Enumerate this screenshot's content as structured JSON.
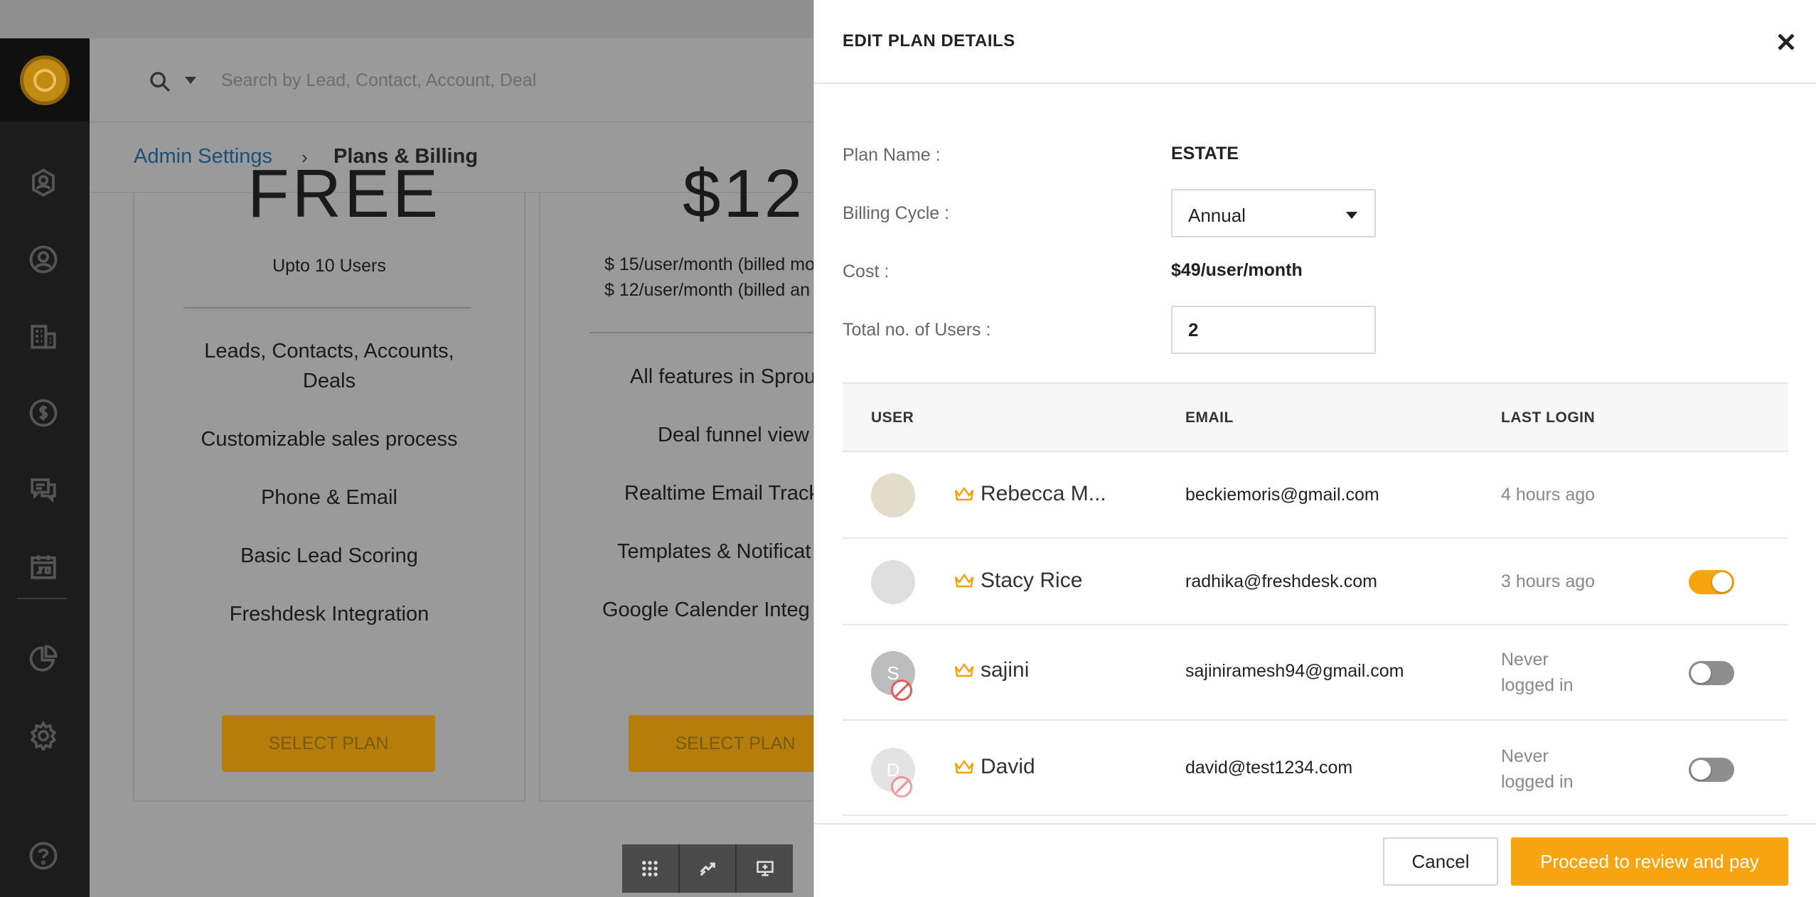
{
  "search": {
    "placeholder": "Search by Lead, Contact, Account, Deal"
  },
  "breadcrumb": {
    "parent": "Admin Settings",
    "separator": "›",
    "current": "Plans & Billing"
  },
  "plans": [
    {
      "price": "FREE",
      "subtitle_lines": [
        "Upto 10 Users"
      ],
      "features": [
        "Leads, Contacts, Accounts, Deals",
        "Customizable sales process",
        "Phone & Email",
        "Basic Lead Scoring",
        "Freshdesk Integration"
      ],
      "button": "SELECT PLAN"
    },
    {
      "price": "$12",
      "subtitle_lines": [
        "$ 15/user/month (billed mo",
        "$ 12/user/month (billed an"
      ],
      "features": [
        "All features in Sprou",
        "Deal funnel view",
        "Realtime Email Track",
        "Templates & Notificat",
        "Google Calender Integ"
      ],
      "button": "SELECT PLAN"
    }
  ],
  "panel": {
    "title": "EDIT PLAN DETAILS",
    "plan_name_label": "Plan Name :",
    "plan_name": "ESTATE",
    "billing_cycle_label": "Billing Cycle :",
    "billing_cycle": "Annual",
    "cost_label": "Cost :",
    "cost": "$49/user/month",
    "users_label": "Total no. of Users :",
    "users": "2",
    "table_headers": {
      "user": "USER",
      "email": "EMAIL",
      "last_login": "LAST LOGIN"
    },
    "rows": [
      {
        "initial": "",
        "name": "Rebecca M...",
        "email": "beckiemoris@gmail.com",
        "last_login": "4 hours ago",
        "avatar_color": "#e4dccb",
        "blocked": false,
        "toggle": null
      },
      {
        "initial": "",
        "name": "Stacy Rice",
        "email": "radhika@freshdesk.com",
        "last_login": "3 hours ago",
        "avatar_color": "#dedede",
        "blocked": false,
        "toggle": "on"
      },
      {
        "initial": "S",
        "name": "sajini",
        "email": "sajiniramesh94@gmail.com",
        "last_login": "Never logged in",
        "avatar_color": "#bdbdbd",
        "blocked": true,
        "toggle": "off"
      },
      {
        "initial": "D",
        "name": "David",
        "email": "david@test1234.com",
        "last_login": "Never logged in",
        "avatar_color": "#e3e3e3",
        "blocked": true,
        "toggle": "off"
      }
    ],
    "cancel": "Cancel",
    "proceed": "Proceed to review and pay"
  },
  "colors": {
    "accent": "#f6a40f",
    "link": "#1d4f78",
    "danger": "#e05a5a"
  }
}
